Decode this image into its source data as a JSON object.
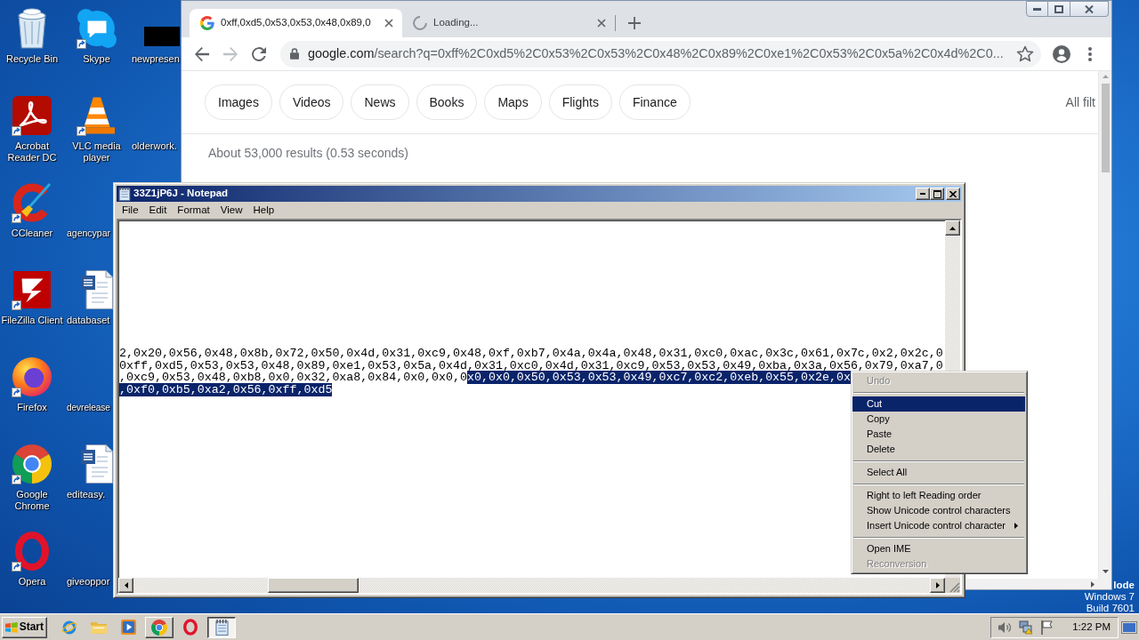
{
  "desktop": {
    "icons": [
      [
        {
          "label": "Recycle Bin",
          "kind": "recycle",
          "shortcut": false
        },
        {
          "label": "Acrobat Reader DC",
          "kind": "acrobat",
          "shortcut": true
        },
        {
          "label": "CCleaner",
          "kind": "ccleaner",
          "shortcut": true
        },
        {
          "label": "FileZilla Client",
          "kind": "filezilla",
          "shortcut": true
        },
        {
          "label": "Firefox",
          "kind": "firefox",
          "shortcut": true
        },
        {
          "label": "Google Chrome",
          "kind": "chrome",
          "shortcut": true
        },
        {
          "label": "Opera",
          "kind": "opera",
          "shortcut": true
        }
      ],
      [
        {
          "label": "Skype",
          "kind": "skype",
          "shortcut": true
        },
        {
          "label": "VLC media player",
          "kind": "vlc",
          "shortcut": true
        },
        {
          "label": "agencypar",
          "kind": "blank",
          "shortcut": false
        },
        {
          "label": "databaset",
          "kind": "word",
          "shortcut": false
        },
        {
          "label": "devrelease",
          "kind": "blank",
          "shortcut": false
        },
        {
          "label": "editeasy.",
          "kind": "word",
          "shortcut": false
        },
        {
          "label": "giveoppor",
          "kind": "blank",
          "shortcut": false
        }
      ],
      [
        {
          "label": "newpresen",
          "kind": "censored",
          "shortcut": false
        },
        {
          "label": "olderwork.",
          "kind": "blank",
          "shortcut": false
        }
      ]
    ],
    "system_text": [
      "lode",
      "Windows 7",
      "Build 7601"
    ]
  },
  "browser": {
    "tabs": [
      {
        "kind": "google",
        "title": "0xff,0xd5,0x53,0x53,0x48,0x89,0",
        "selected": true
      },
      {
        "kind": "loading",
        "title": "Loading...",
        "selected": false
      }
    ],
    "nav": [
      {
        "kind": "back",
        "disabled": false
      },
      {
        "kind": "forward",
        "disabled": true
      },
      {
        "kind": "reload",
        "disabled": false
      }
    ],
    "address": {
      "host": "google.com",
      "path": "/search?q=0xff%2C0xd5%2C0x53%2C0x53%2C0x48%2C0x89%2C0xe1%2C0x53%2C0x5a%2C0x4d%2C0..."
    },
    "search_tabs": [
      "Images",
      "Videos",
      "News",
      "Books",
      "Maps",
      "Flights",
      "Finance"
    ],
    "filters": "All filt",
    "result_stats": "About 53,000 results (0.53 seconds)"
  },
  "notepad": {
    "title": "33Z1jP6J - Notepad",
    "menu": [
      "File",
      "Edit",
      "Format",
      "View",
      "Help"
    ],
    "lines": [
      [
        {
          "text": "2,0x20,0x56,0x48,0x8b,0x72,0x50,0x4d,0x31,0xc9,0x48,0xf,0xb7,0x4a,0x4a,0x48,0x31,0xc0,0xac,0x3c,0x61,0x7c,0x2,0x2c,0",
          "selected": false
        }
      ],
      [
        {
          "text": "0xff,0xd5,0x53,0x53,0x48,0x89,0xe1,0x53,0x5a,0x4d,0x31,0xc0,0x4d,0x31,0xc9,0x53,0x53,0x49,0xba,0x3a,0x56,0x79,0xa7,0",
          "selected": false
        }
      ],
      [
        {
          "text": ",0xc9,0x53,0x48,0xb8,0x0,0x32,0xa8,0x84,0x0,0x0,0",
          "selected": false
        },
        {
          "text": "x0,0x0,0x50,0x53,0x53,0x49,0xc7,0xc2,0xeb,0x55,0x2e,0x",
          "selected": true
        }
      ],
      [
        {
          "text": ",0xf0,0xb5,0xa2,0x56,0xff,0xd5",
          "selected": true
        }
      ]
    ]
  },
  "context_menu": [
    {
      "kind": "item",
      "label": "Undo",
      "disabled": true,
      "selected": false,
      "submenu": false
    },
    {
      "kind": "separator"
    },
    {
      "kind": "item",
      "label": "Cut",
      "disabled": false,
      "selected": true,
      "submenu": false
    },
    {
      "kind": "item",
      "label": "Copy",
      "disabled": false,
      "selected": false,
      "submenu": false
    },
    {
      "kind": "item",
      "label": "Paste",
      "disabled": false,
      "selected": false,
      "submenu": false
    },
    {
      "kind": "item",
      "label": "Delete",
      "disabled": false,
      "selected": false,
      "submenu": false
    },
    {
      "kind": "separator"
    },
    {
      "kind": "item",
      "label": "Select All",
      "disabled": false,
      "selected": false,
      "submenu": false
    },
    {
      "kind": "separator"
    },
    {
      "kind": "item",
      "label": "Right to left Reading order",
      "disabled": false,
      "selected": false,
      "submenu": false
    },
    {
      "kind": "item",
      "label": "Show Unicode control characters",
      "disabled": false,
      "selected": false,
      "submenu": false
    },
    {
      "kind": "item",
      "label": "Insert Unicode control character",
      "disabled": false,
      "selected": false,
      "submenu": true
    },
    {
      "kind": "separator"
    },
    {
      "kind": "item",
      "label": "Open IME",
      "disabled": false,
      "selected": false,
      "submenu": false
    },
    {
      "kind": "item",
      "label": "Reconversion",
      "disabled": true,
      "selected": false,
      "submenu": false
    }
  ],
  "taskbar": {
    "start": "Start",
    "items": [
      {
        "kind": "ie",
        "open": false,
        "selected": false
      },
      {
        "kind": "folder",
        "open": false,
        "selected": false
      },
      {
        "kind": "media",
        "open": false,
        "selected": false
      },
      {
        "kind": "chrome",
        "open": true,
        "selected": false
      },
      {
        "kind": "opera",
        "open": false,
        "selected": false
      },
      {
        "kind": "notepad",
        "open": true,
        "selected": true
      }
    ],
    "tray": [
      {
        "kind": "speaker"
      },
      {
        "kind": "network"
      },
      {
        "kind": "flag"
      }
    ],
    "clock": "1:22 PM"
  }
}
